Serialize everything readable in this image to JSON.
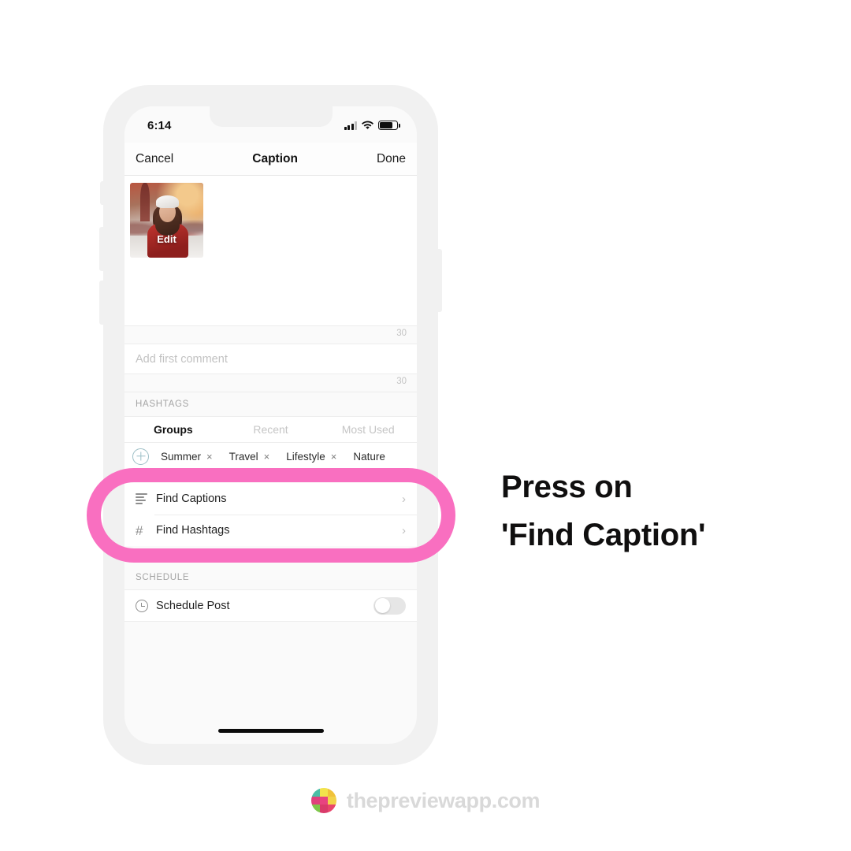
{
  "phone": {
    "status_bar": {
      "time": "6:14",
      "signal_icon": "cellular-signal-icon",
      "wifi_icon": "wifi-icon",
      "battery_icon": "battery-icon"
    },
    "nav_bar": {
      "cancel_label": "Cancel",
      "title": "Caption",
      "done_label": "Done"
    },
    "caption_section": {
      "thumbnail_edit_label": "Edit",
      "caption_counter": "30",
      "comment_placeholder": "Add first comment",
      "comment_counter": "30"
    },
    "hashtags_section": {
      "label": "HASHTAGS",
      "tabs": [
        {
          "label": "Groups",
          "active": true
        },
        {
          "label": "Recent",
          "active": false
        },
        {
          "label": "Most Used",
          "active": false
        }
      ],
      "add_icon": "plus-circle-icon",
      "chips": [
        {
          "label": "Summer",
          "remove": "×"
        },
        {
          "label": "Travel",
          "remove": "×"
        },
        {
          "label": "Lifestyle",
          "remove": "×"
        },
        {
          "label": "Nature",
          "remove": ""
        }
      ]
    },
    "menu_rows": [
      {
        "label": "Find Captions",
        "icon": "text-lines-icon",
        "chevron": "›"
      },
      {
        "label": "Find Hashtags",
        "icon": "hashtag-icon",
        "chevron": "›"
      }
    ],
    "schedule_section": {
      "label": "SCHEDULE",
      "row_label": "Schedule Post",
      "icon": "clock-icon",
      "toggle_state": "off"
    }
  },
  "callout": {
    "line1": "Press on",
    "line2": "'Find Caption'"
  },
  "footer": {
    "brand": "thepreviewapp.com",
    "logo_icon": "preview-app-logo-icon",
    "logo_colors": [
      "#4bbfa6",
      "#f2e34c",
      "#f0c23a",
      "#e0407d",
      "#e8437f",
      "#f2d24a",
      "#7ec64a",
      "#d93a6a",
      "#e8456c"
    ]
  },
  "colors": {
    "accent_pink": "#f96fc0",
    "frame": "#f1f1f1",
    "screen_bg": "#fafafa"
  }
}
